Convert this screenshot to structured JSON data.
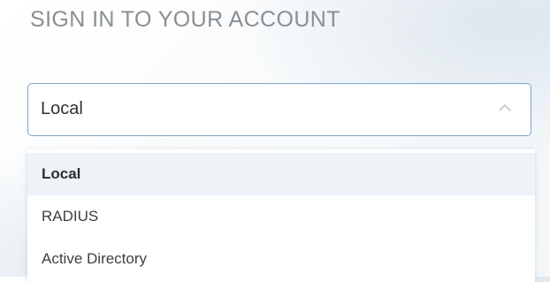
{
  "heading": "SIGN IN TO YOUR ACCOUNT",
  "auth_select": {
    "selected_value": "Local",
    "open": true,
    "chevron_icon": "chevron-up-icon",
    "options": [
      {
        "label": "Local",
        "highlighted": true
      },
      {
        "label": "RADIUS",
        "highlighted": false
      },
      {
        "label": "Active Directory",
        "highlighted": false
      }
    ]
  },
  "colors": {
    "focus_border": "#7aa6cf",
    "heading_text": "#8b8f93",
    "highlight_bg": "#eef3f8"
  }
}
